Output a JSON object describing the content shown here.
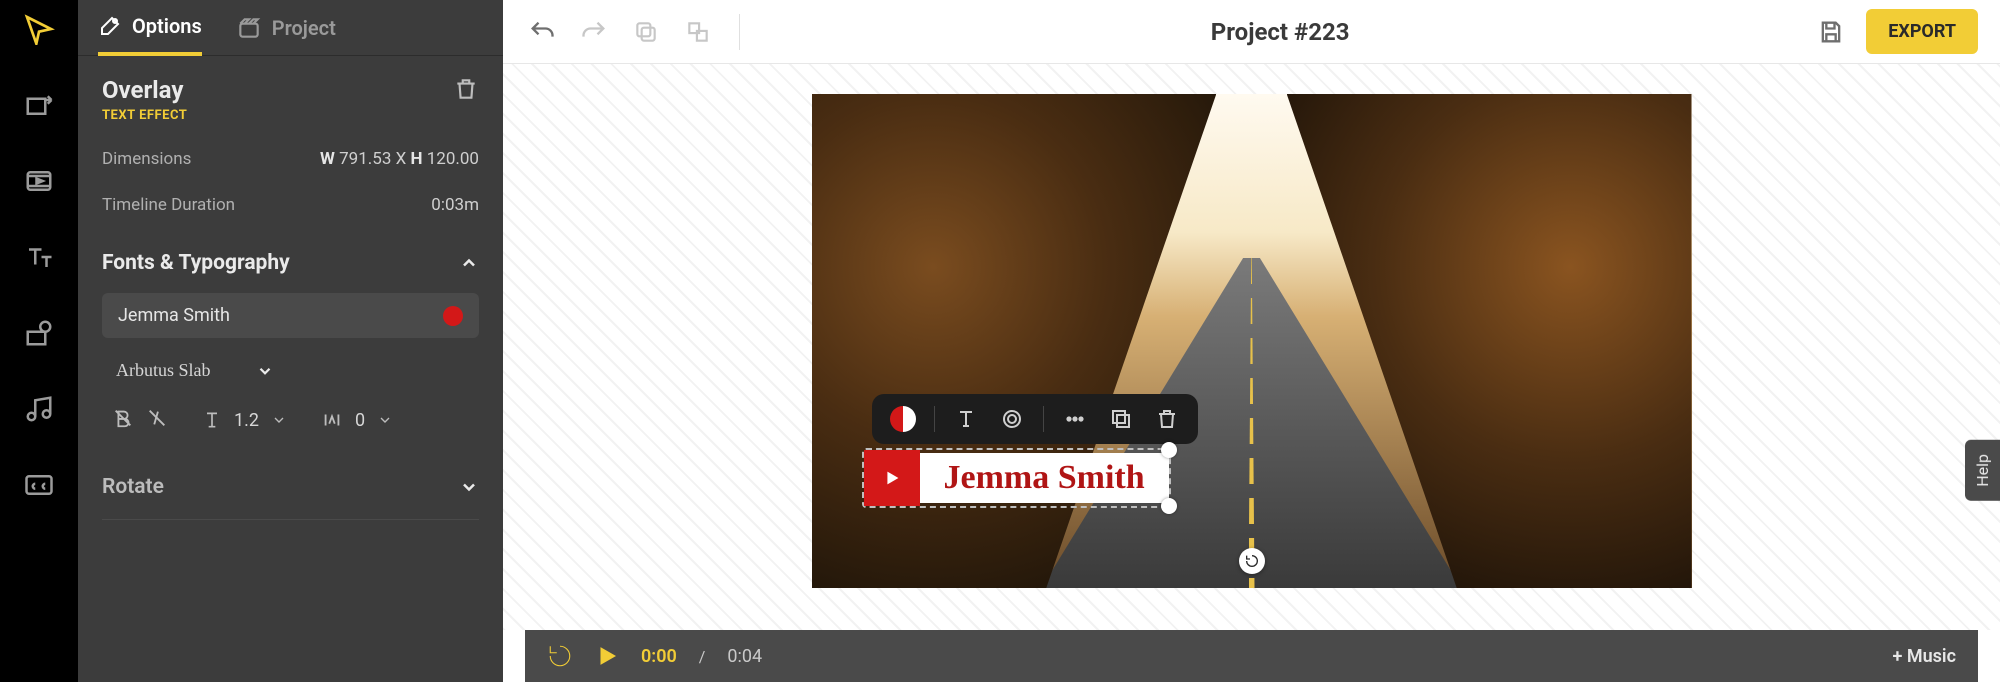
{
  "panel": {
    "tabs": {
      "options": "Options",
      "project": "Project"
    },
    "overlay_title": "Overlay",
    "overlay_sub": "TEXT EFFECT",
    "dim_label": "Dimensions",
    "dim_w_prefix": "W",
    "dim_w": "791.53",
    "dim_sep": "X",
    "dim_h_prefix": "H",
    "dim_h": "120.00",
    "dur_label": "Timeline Duration",
    "dur_val": "0:03m",
    "fonts_section": "Fonts & Typography",
    "text_value": "Jemma Smith",
    "font_name": "Arbutus Slab",
    "line_height": "1.2",
    "letter_spacing": "0",
    "rotate_section": "Rotate"
  },
  "topbar": {
    "project_title": "Project #223",
    "export": "EXPORT"
  },
  "overlay_text": "Jemma Smith",
  "playbar": {
    "current": "0:00",
    "sep": "/",
    "total": "0:04",
    "add_music": "+ Music"
  },
  "help": "Help",
  "colors": {
    "accent": "#f2cd36",
    "overlay_red": "#d31818"
  }
}
